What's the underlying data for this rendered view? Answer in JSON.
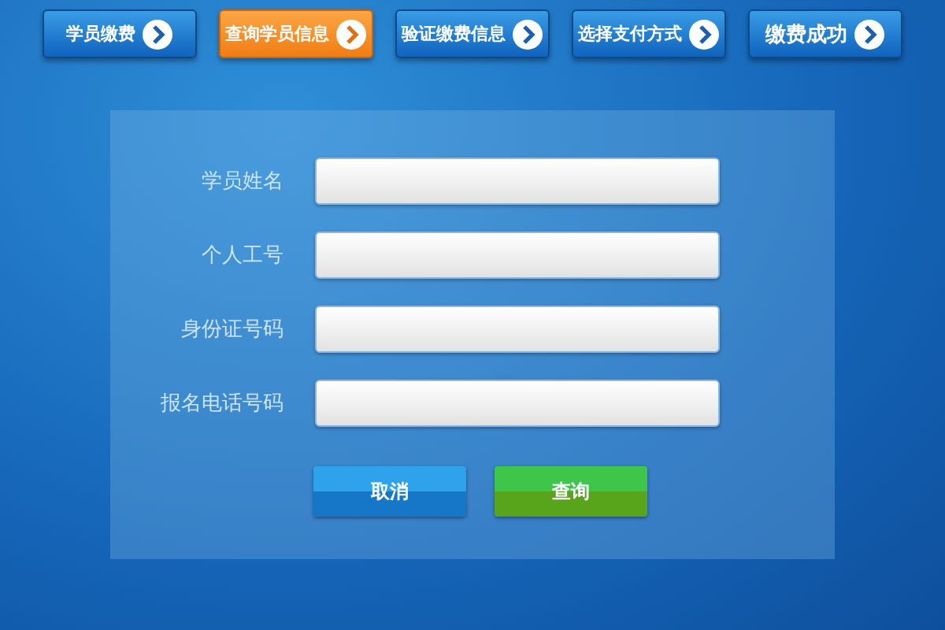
{
  "steps": [
    {
      "label": "学员缴费",
      "selected": false
    },
    {
      "label": "查询学员信息",
      "selected": true
    },
    {
      "label": "验证缴费信息",
      "selected": false
    },
    {
      "label": "选择支付方式",
      "selected": false
    },
    {
      "label": "缴费成功",
      "selected": false
    }
  ],
  "form": {
    "fields": [
      {
        "label": "学员姓名"
      },
      {
        "label": "个人工号"
      },
      {
        "label": "身份证号码"
      },
      {
        "label": "报名电话号码"
      }
    ],
    "buttons": [
      {
        "label": "取消",
        "kind": "cancel"
      },
      {
        "label": "查询",
        "kind": "submit"
      }
    ]
  }
}
